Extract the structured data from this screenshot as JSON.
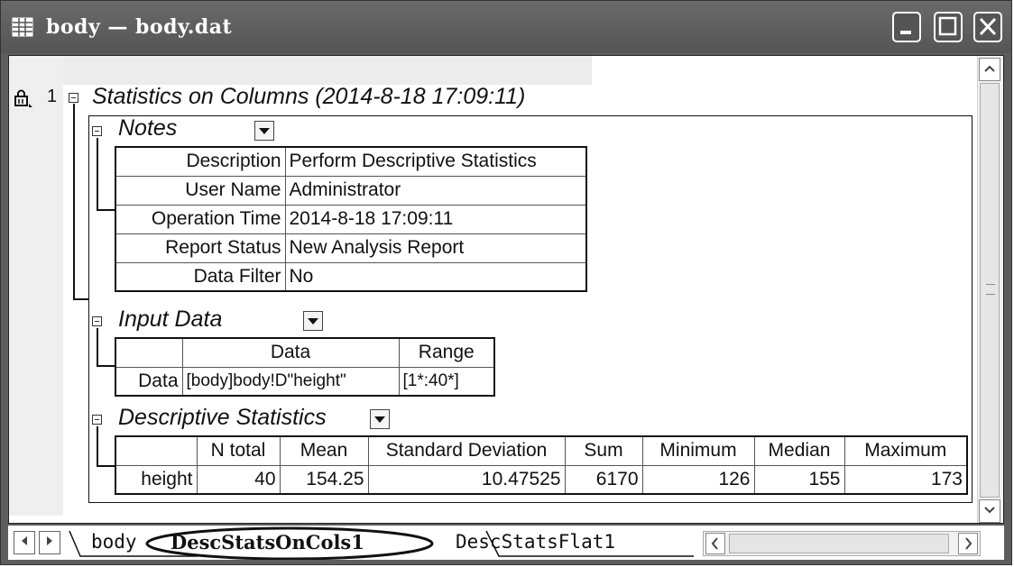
{
  "window": {
    "title": "body — body.dat"
  },
  "report": {
    "row_number": "1",
    "title": "Statistics on Columns (2014-8-18 17:09:11)",
    "notes": {
      "heading": "Notes",
      "rows": [
        {
          "label": "Description",
          "value": "Perform Descriptive Statistics"
        },
        {
          "label": "User Name",
          "value": "Administrator"
        },
        {
          "label": "Operation Time",
          "value": "2014-8-18 17:09:11"
        },
        {
          "label": "Report Status",
          "value": "New Analysis Report"
        },
        {
          "label": "Data Filter",
          "value": "No"
        }
      ]
    },
    "input_data": {
      "heading": "Input Data",
      "col_data": "Data",
      "col_range": "Range",
      "row_label": "Data",
      "row_data": "[body]body!D\"height\"",
      "row_range": "[1*:40*]"
    },
    "descriptive": {
      "heading": "Descriptive Statistics",
      "columns": [
        "N total",
        "Mean",
        "Standard Deviation",
        "Sum",
        "Minimum",
        "Median",
        "Maximum"
      ],
      "row": {
        "label": "height",
        "values": [
          "40",
          "154.25",
          "10.47525",
          "6170",
          "126",
          "155",
          "173"
        ]
      }
    }
  },
  "sheet_tabs": [
    "body",
    "DescStatsOnCols1",
    "DescStatsFlat1"
  ],
  "colors": {
    "titlebar": "#5d5d5d",
    "client_bg": "#ffffff",
    "gutter": "#efefef"
  },
  "icons": [
    "sheet-grid-icon",
    "lock-icon",
    "minimize-icon",
    "maximize-icon",
    "close-icon",
    "dropdown-arrow-icon"
  ]
}
